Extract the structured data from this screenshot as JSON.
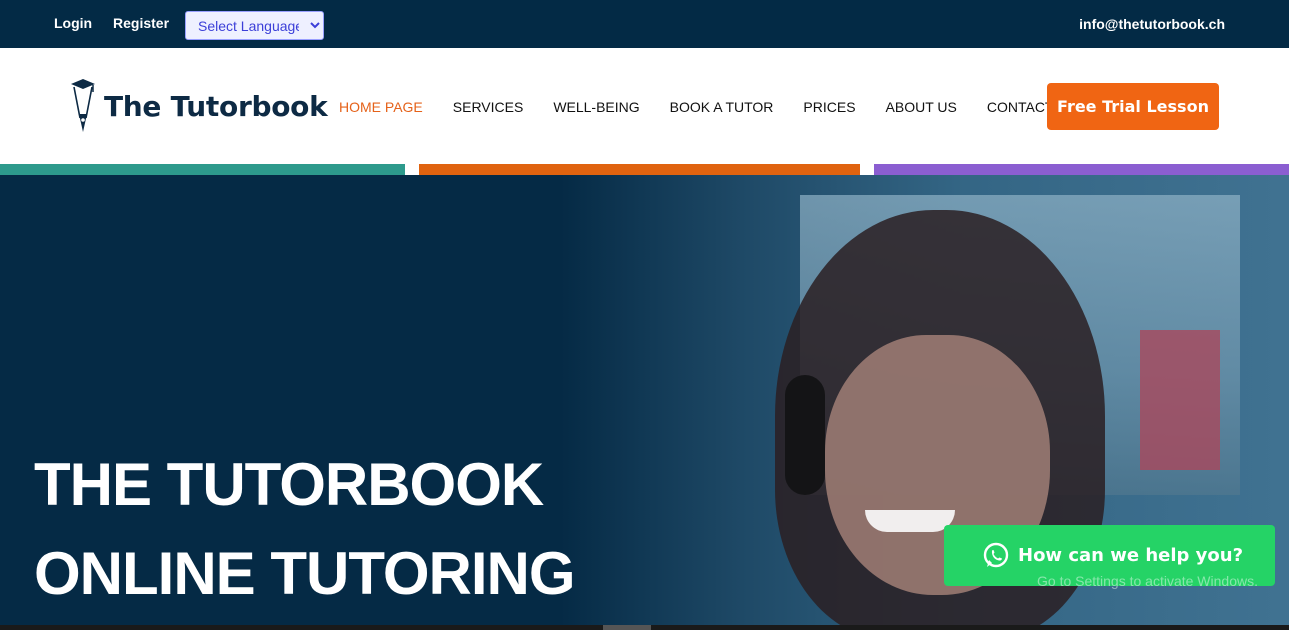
{
  "topbar": {
    "login": "Login",
    "register": "Register",
    "language_select": "Select Language",
    "email": "info@thetutorbook.ch"
  },
  "header": {
    "brand": "The Tutorbook",
    "nav": [
      {
        "label": "HOME PAGE",
        "active": true
      },
      {
        "label": "SERVICES",
        "active": false
      },
      {
        "label": "WELL-BEING",
        "active": false
      },
      {
        "label": "BOOK A TUTOR",
        "active": false
      },
      {
        "label": "PRICES",
        "active": false
      },
      {
        "label": "ABOUT US",
        "active": false
      },
      {
        "label": "CONTACT",
        "active": false
      }
    ],
    "cta": "Free Trial Lesson"
  },
  "colors": {
    "navy": "#032a45",
    "orange": "#f06513",
    "teal": "#2d9a8c",
    "purple": "#8b5ed1",
    "whatsapp_green": "#25d366"
  },
  "hero": {
    "title_line1": "THE TUTORBOOK",
    "title_line2": "ONLINE TUTORING"
  },
  "whatsapp": {
    "icon": "whatsapp-icon",
    "label": "How can we help you?"
  },
  "overlay": {
    "activate_windows": "Go to Settings to activate Windows."
  }
}
